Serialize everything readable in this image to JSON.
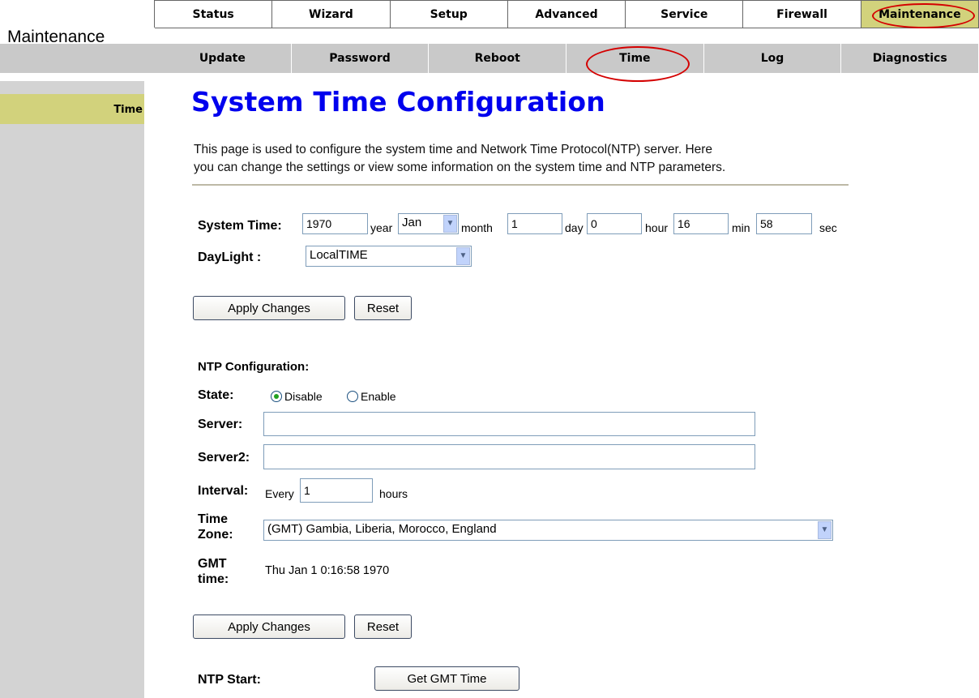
{
  "header": {
    "section_title": "Maintenance"
  },
  "nav": {
    "main_tabs": [
      {
        "label": "Status"
      },
      {
        "label": "Wizard"
      },
      {
        "label": "Setup"
      },
      {
        "label": "Advanced"
      },
      {
        "label": "Service"
      },
      {
        "label": "Firewall"
      },
      {
        "label": "Maintenance",
        "active": true
      }
    ],
    "sub_tabs": [
      {
        "label": "Update"
      },
      {
        "label": "Password"
      },
      {
        "label": "Reboot"
      },
      {
        "label": "Time",
        "active": true
      },
      {
        "label": "Log"
      },
      {
        "label": "Diagnostics"
      }
    ]
  },
  "sidebar": {
    "items": [
      {
        "label": "Time"
      }
    ]
  },
  "main": {
    "title": "System Time Configuration",
    "description_line1": "This page is used to configure the system time and Network Time Protocol(NTP) server. Here",
    "description_line2": "you can change the settings or view some information on the system time and NTP parameters.",
    "system_time": {
      "label": "System Time:",
      "year_value": "1970",
      "year_unit": "year",
      "month_value": "Jan",
      "month_unit": "month",
      "day_value": "1",
      "day_unit": "day",
      "hour_value": "0",
      "hour_unit": "hour",
      "min_value": "16",
      "min_unit": "min",
      "sec_value": "58",
      "sec_unit": "sec"
    },
    "daylight": {
      "label": "DayLight :",
      "value": "LocalTIME"
    },
    "apply_label": "Apply Changes",
    "reset_label": "Reset",
    "ntp": {
      "heading": "NTP Configuration:",
      "state_label": "State:",
      "disable_label": "Disable",
      "enable_label": "Enable",
      "state_selected": "Disable",
      "server_label": "Server:",
      "server_value": "",
      "server2_label": "Server2:",
      "server2_value": "",
      "interval_label": "Interval:",
      "interval_prefix": "Every",
      "interval_value": "1",
      "interval_unit": "hours",
      "timezone_label_line1": "Time",
      "timezone_label_line2": "Zone:",
      "timezone_value": "(GMT) Gambia, Liberia, Morocco, England",
      "gmt_label_line1": "GMT",
      "gmt_label_line2": "time:",
      "gmt_value": "Thu Jan 1 0:16:58 1970",
      "apply_label": "Apply Changes",
      "reset_label": "Reset",
      "start_label": "NTP Start:",
      "get_gmt_label": "Get GMT Time"
    }
  },
  "colors": {
    "active_tab": "#d2d27c",
    "subnav_bg": "#c9c9c9",
    "sidebar_bg": "#d3d3d3",
    "title_blue": "#0000ee",
    "annotation_red": "#d40000"
  }
}
